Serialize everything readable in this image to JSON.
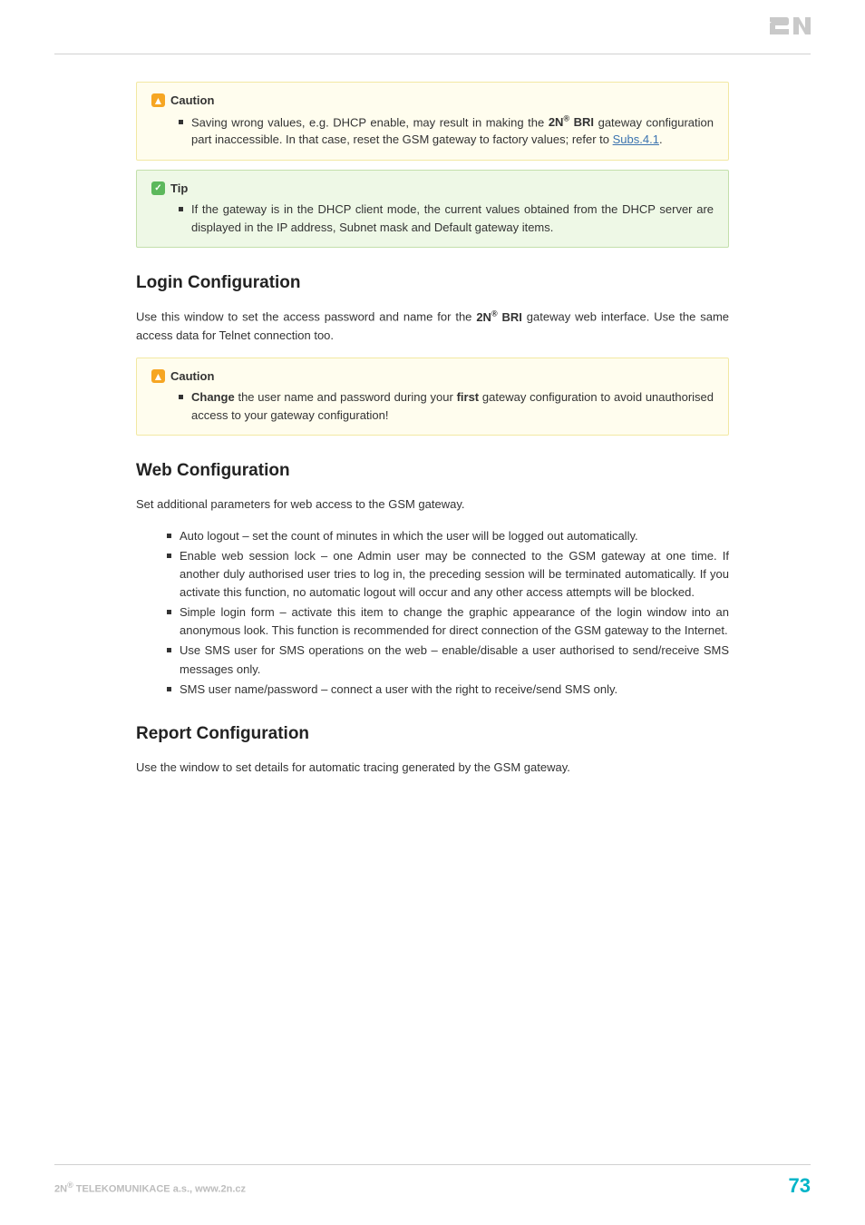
{
  "callout1": {
    "title": "Caution",
    "text_prefix": "Saving wrong values, e.g. DHCP enable, may result in making the ",
    "product_prefix": "2N",
    "product_reg": "®",
    "product_suffix": " BRI",
    "text_mid": " gateway configuration part inaccessible. In that case, reset the GSM gateway to factory values; refer to ",
    "link": "Subs.4.1",
    "text_end": "."
  },
  "callout2": {
    "title": "Tip",
    "text": "If the gateway is in the DHCP client mode, the current values obtained from the DHCP server are displayed in the IP address, Subnet mask and Default gateway items."
  },
  "login": {
    "heading": "Login Configuration",
    "para_prefix": "Use this window to set the access password and name for the ",
    "product_prefix": "2N",
    "product_reg": "®",
    "product_suffix": " BRI",
    "para_suffix": " gateway web interface. Use the same access data for Telnet connection too."
  },
  "callout3": {
    "title": "Caution",
    "w1": "Change",
    "t1": " the user name and password during your ",
    "w2": "first",
    "t2": " gateway configuration to avoid unauthorised access to your gateway configuration!"
  },
  "web": {
    "heading": "Web Configuration",
    "para": "Set additional parameters for web access to the GSM gateway.",
    "items": [
      "Auto logout – set the count of minutes in which the user will be logged out automatically.",
      "Enable web session lock – one Admin user may be connected to the GSM gateway at one time. If another duly authorised user tries to log in, the preceding session will be terminated automatically. If you activate this function, no automatic logout will occur and any other access attempts will be blocked.",
      "Simple login form – activate this item to change the graphic appearance of the login window into an anonymous look. This function is recommended for direct connection of the GSM gateway to the Internet.",
      "Use SMS user for SMS operations on the web – enable/disable a user authorised to send/receive SMS messages only.",
      "SMS user name/password – connect a user with the right to receive/send SMS only."
    ]
  },
  "report": {
    "heading": "Report Configuration",
    "para": "Use the window to set details for automatic tracing generated by the GSM gateway."
  },
  "footer": {
    "left_prefix": "2N",
    "left_reg": "®",
    "left_suffix": " TELEKOMUNIKACE a.s., www.2n.cz",
    "page": "73"
  }
}
